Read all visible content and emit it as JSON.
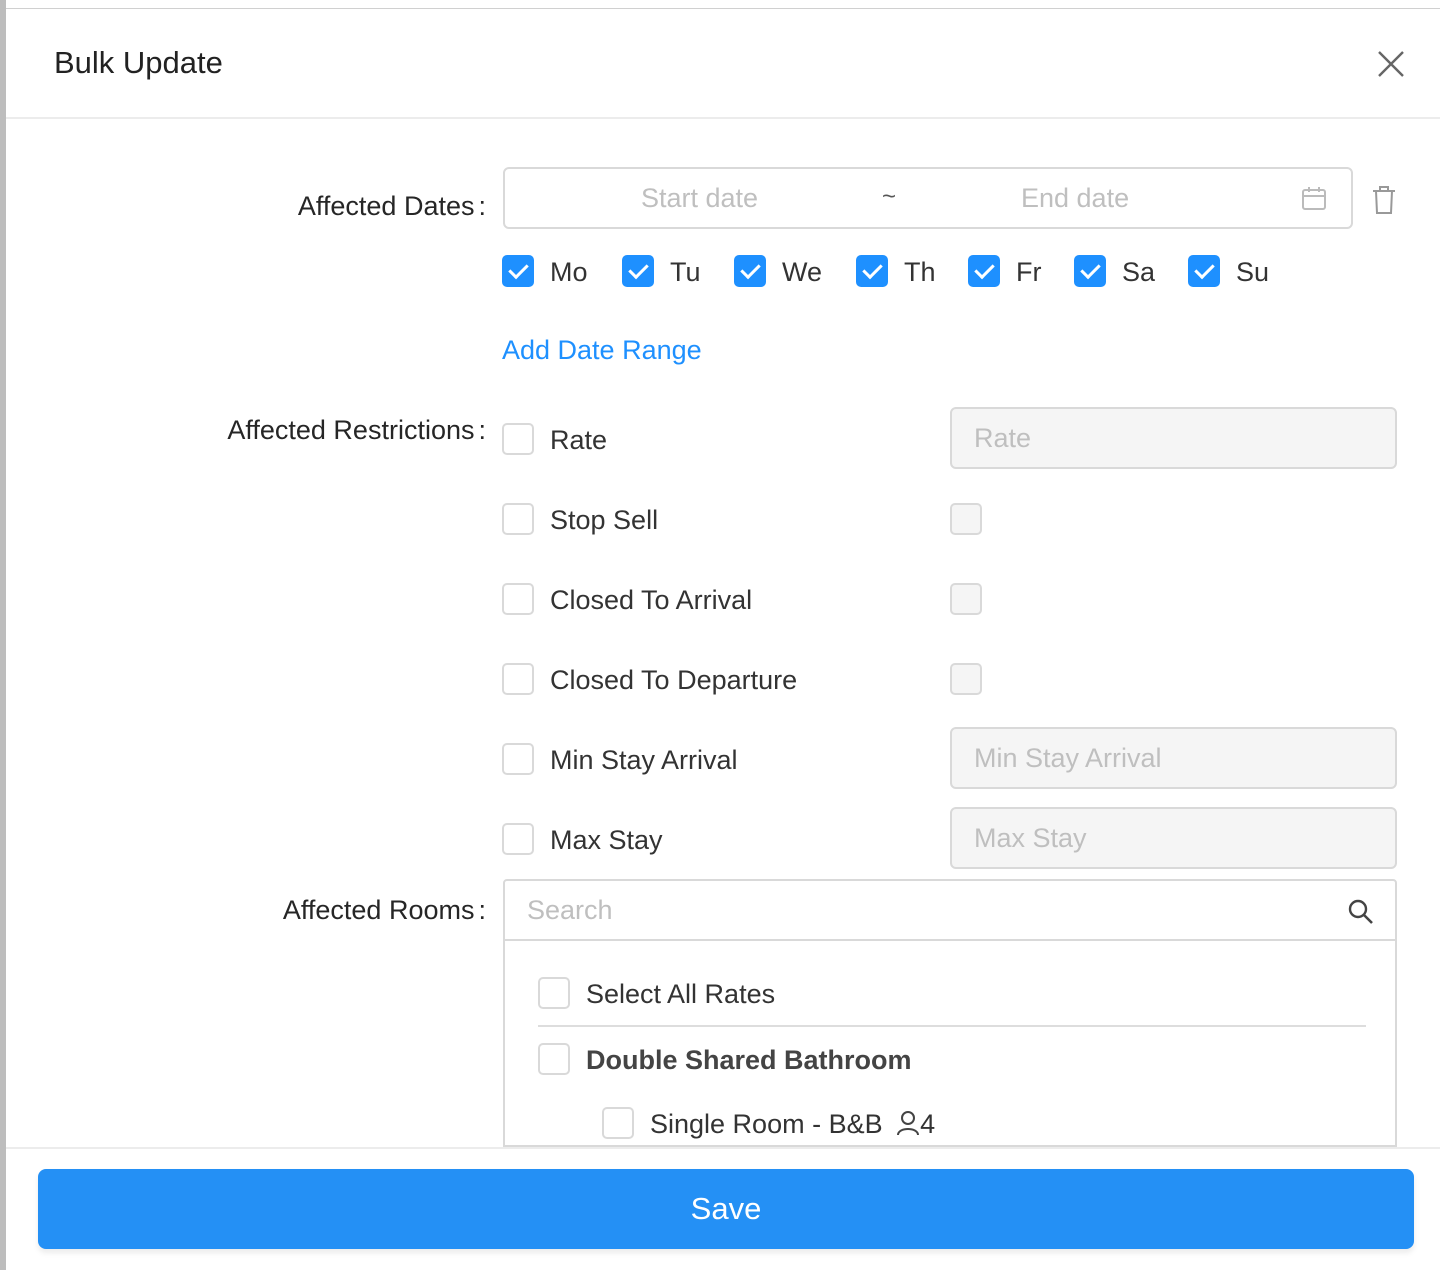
{
  "modal": {
    "title": "Bulk Update",
    "close_icon": "close-icon"
  },
  "dates": {
    "label": "Affected Dates",
    "colon": ":",
    "start_placeholder": "Start date",
    "separator": "~",
    "end_placeholder": "End date",
    "days": [
      {
        "label": "Mo",
        "checked": true
      },
      {
        "label": "Tu",
        "checked": true
      },
      {
        "label": "We",
        "checked": true
      },
      {
        "label": "Th",
        "checked": true
      },
      {
        "label": "Fr",
        "checked": true
      },
      {
        "label": "Sa",
        "checked": true
      },
      {
        "label": "Su",
        "checked": true
      }
    ],
    "add_range": "Add Date Range"
  },
  "restrictions": {
    "label": "Affected Restrictions",
    "colon": ":",
    "items": [
      {
        "label": "Rate",
        "placeholder": "Rate"
      },
      {
        "label": "Stop Sell"
      },
      {
        "label": "Closed To Arrival"
      },
      {
        "label": "Closed To Departure"
      },
      {
        "label": "Min Stay Arrival",
        "placeholder": "Min Stay Arrival"
      },
      {
        "label": "Max Stay",
        "placeholder": "Max Stay"
      }
    ]
  },
  "rooms": {
    "label": "Affected Rooms",
    "colon": ":",
    "search_placeholder": "Search",
    "select_all": "Select All Rates",
    "room_name": "Double Shared Bathroom",
    "rate_name": "Single Room - B&B",
    "occupancy": "4"
  },
  "footer": {
    "save": "Save"
  },
  "colors": {
    "accent": "#1e90ff",
    "save": "#2490f5"
  }
}
